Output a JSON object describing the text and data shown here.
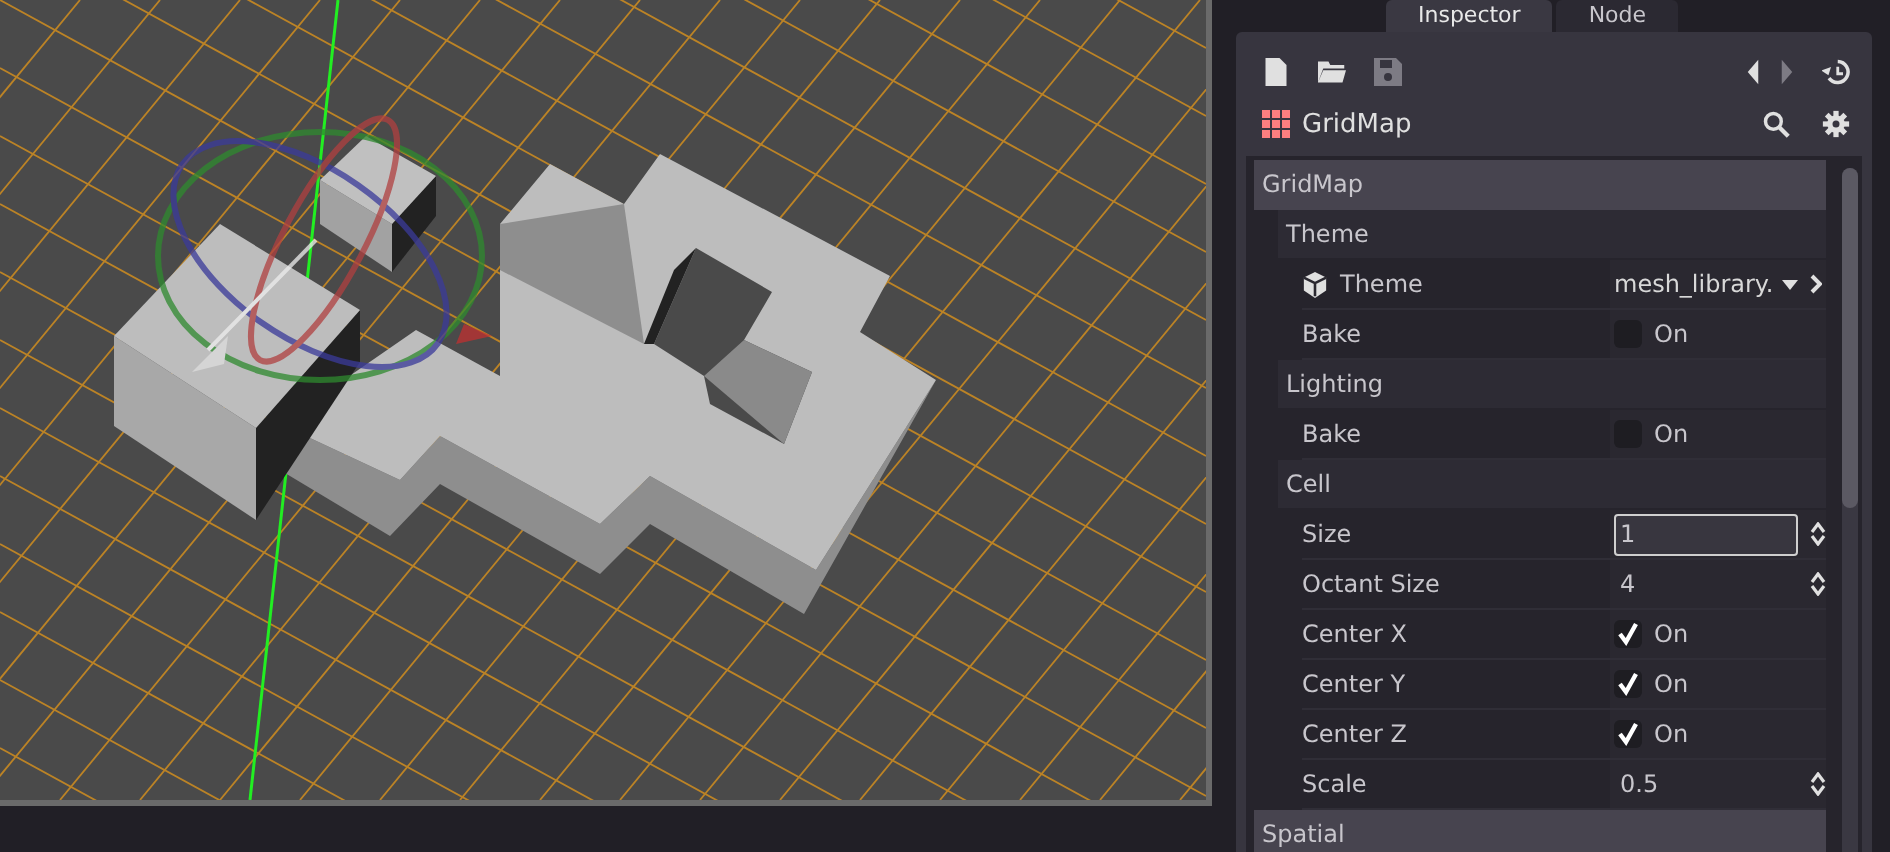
{
  "tabs": [
    {
      "label": "Inspector",
      "selected": true
    },
    {
      "label": "Node",
      "selected": false
    }
  ],
  "object": {
    "name": "GridMap"
  },
  "properties": [
    {
      "kind": "category",
      "label": "GridMap"
    },
    {
      "kind": "section",
      "label": "Theme"
    },
    {
      "kind": "resource",
      "label": "Theme",
      "value": "mesh_library."
    },
    {
      "kind": "check",
      "label": "Bake",
      "checked": false,
      "text": "On"
    },
    {
      "kind": "section",
      "label": "Lighting"
    },
    {
      "kind": "check",
      "label": "Bake",
      "checked": false,
      "text": "On"
    },
    {
      "kind": "section",
      "label": "Cell"
    },
    {
      "kind": "spin",
      "label": "Size",
      "value": "1",
      "editing": true
    },
    {
      "kind": "spin",
      "label": "Octant Size",
      "value": "4",
      "editing": false
    },
    {
      "kind": "check",
      "label": "Center X",
      "checked": true,
      "text": "On"
    },
    {
      "kind": "check",
      "label": "Center Y",
      "checked": true,
      "text": "On"
    },
    {
      "kind": "check",
      "label": "Center Z",
      "checked": true,
      "text": "On"
    },
    {
      "kind": "spin",
      "label": "Scale",
      "value": "0.5",
      "editing": false
    },
    {
      "kind": "category",
      "label": "Spatial"
    }
  ]
}
